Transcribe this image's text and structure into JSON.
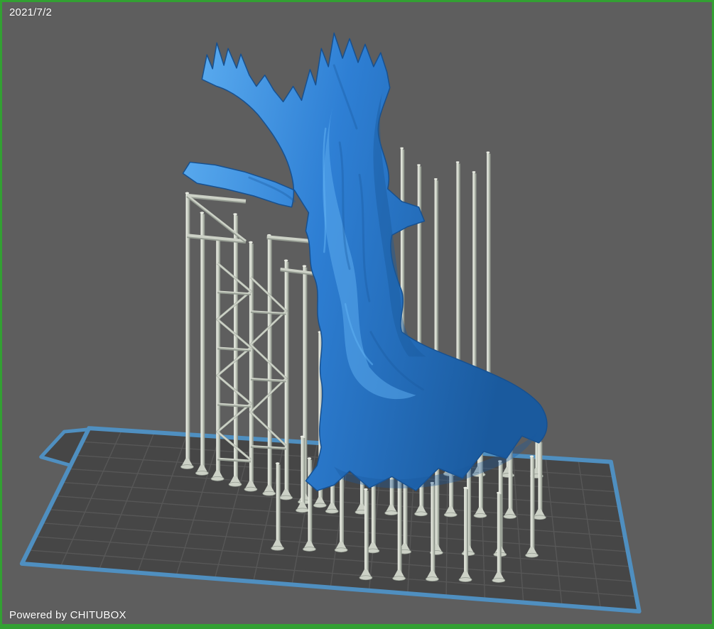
{
  "meta": {
    "date": "2021/7/2",
    "watermark": "Powered by CHITUBOX"
  },
  "colors": {
    "frame_border": "#33a033",
    "background": "#5e5e5e",
    "plate": "#464646",
    "plate_grid": "#575757",
    "plate_edge": "#4f8fc0",
    "support": "#ccd1c6",
    "support_highlight": "#e9ece3",
    "support_shadow": "#959c92",
    "model_light": "#5fb0f2",
    "model_mid": "#2e7fd4",
    "model_dark": "#1a5a9e",
    "model_outline": "#17508f",
    "text": "#ffffff"
  }
}
